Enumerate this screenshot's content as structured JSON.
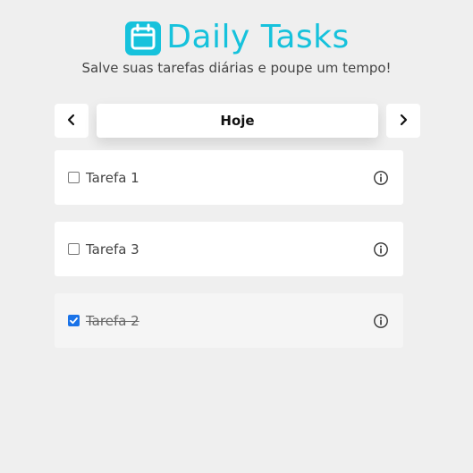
{
  "header": {
    "title": "Daily Tasks",
    "subtitle": "Salve suas tarefas diárias e poupe um tempo!",
    "icon": "calendar-icon",
    "accent_color": "#16c2dc"
  },
  "nav": {
    "day_label": "Hoje",
    "prev_icon": "chevron-left-icon",
    "next_icon": "chevron-right-icon"
  },
  "tasks": [
    {
      "label": "Tarefa 1",
      "checked": false,
      "icon": "info-icon"
    },
    {
      "label": "Tarefa 3",
      "checked": false,
      "icon": "info-icon"
    },
    {
      "label": "Tarefa 2",
      "checked": true,
      "icon": "info-icon"
    }
  ],
  "colors": {
    "background": "#efefef",
    "checkbox_checked": "#1a73e8"
  }
}
